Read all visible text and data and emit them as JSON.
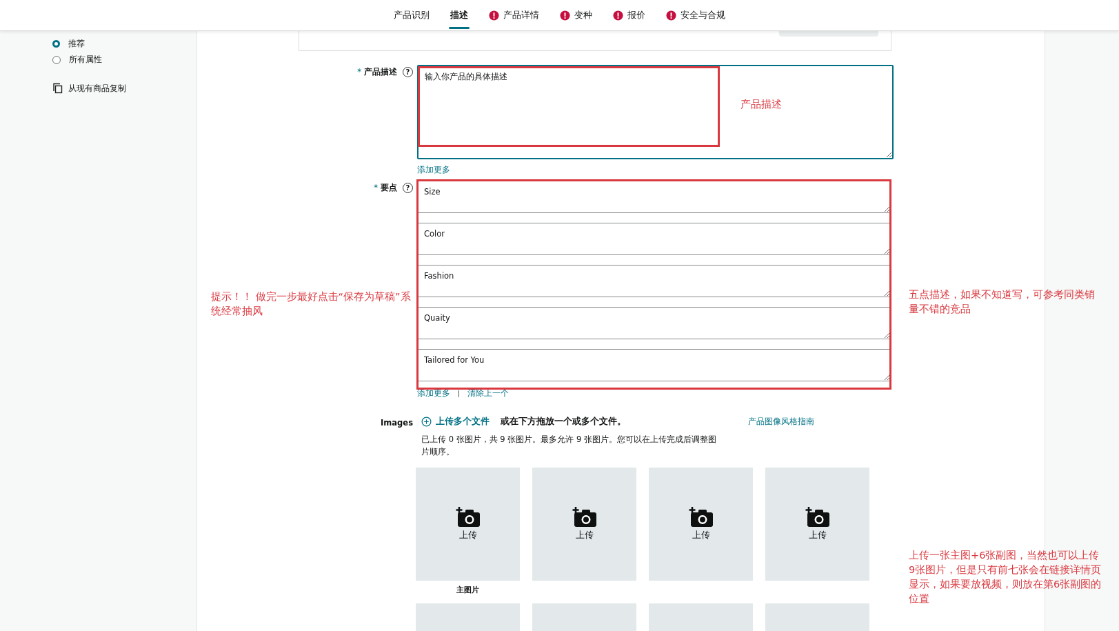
{
  "tabs": [
    {
      "label": "产品识别",
      "selected": false,
      "error": false
    },
    {
      "label": "描述",
      "selected": true,
      "error": false
    },
    {
      "label": "产品详情",
      "selected": false,
      "error": true
    },
    {
      "label": "变种",
      "selected": false,
      "error": true
    },
    {
      "label": "报价",
      "selected": false,
      "error": true
    },
    {
      "label": "安全与合规",
      "selected": false,
      "error": true
    }
  ],
  "sidebar": {
    "options": [
      {
        "label": "推荐",
        "selected": true
      },
      {
        "label": "所有属性",
        "selected": false
      }
    ],
    "copy_link": "从现有商品复制"
  },
  "description": {
    "label": "产品描述",
    "required_mark": "*",
    "help_icon": "?",
    "placeholder": "输入你产品的具体描述",
    "add_more": "添加更多"
  },
  "bullets": {
    "label": "要点",
    "required_mark": "*",
    "help_icon": "?",
    "values": [
      "Size",
      "Color",
      "Fashion",
      "Quaity",
      "Tailored for You"
    ],
    "add_more": "添加更多",
    "remove_last": "清除上一个"
  },
  "images": {
    "label": "Images",
    "upload_link": "上传多个文件",
    "drop_text": "或在下方拖放一个或多个文件。",
    "style_guide": "产品图像风格指南",
    "info": "已上传 0 张图片，共 9 张图片。最多允许 9 张图片。您可以在上传完成后调整图片顺序。",
    "slots": [
      {
        "label": "上传",
        "caption": "主图片"
      },
      {
        "label": "上传"
      },
      {
        "label": "上传"
      },
      {
        "label": "上传"
      }
    ]
  },
  "annotations": [
    {
      "kind": "inline",
      "text": "产品描述"
    },
    {
      "kind": "left",
      "text": "提示！！ 做完一步最好点击“保存为草稿”系统经常抽风"
    },
    {
      "kind": "right",
      "text": "五点描述，如果不知道写，可参考同类销量不错的竞品"
    },
    {
      "kind": "right",
      "text": "上传一张主图+6张副图，当然也可以上传9张图片，但是只有前七张会在链接详情页显示，如果要放视频，则放在第6张副图的位置"
    }
  ]
}
